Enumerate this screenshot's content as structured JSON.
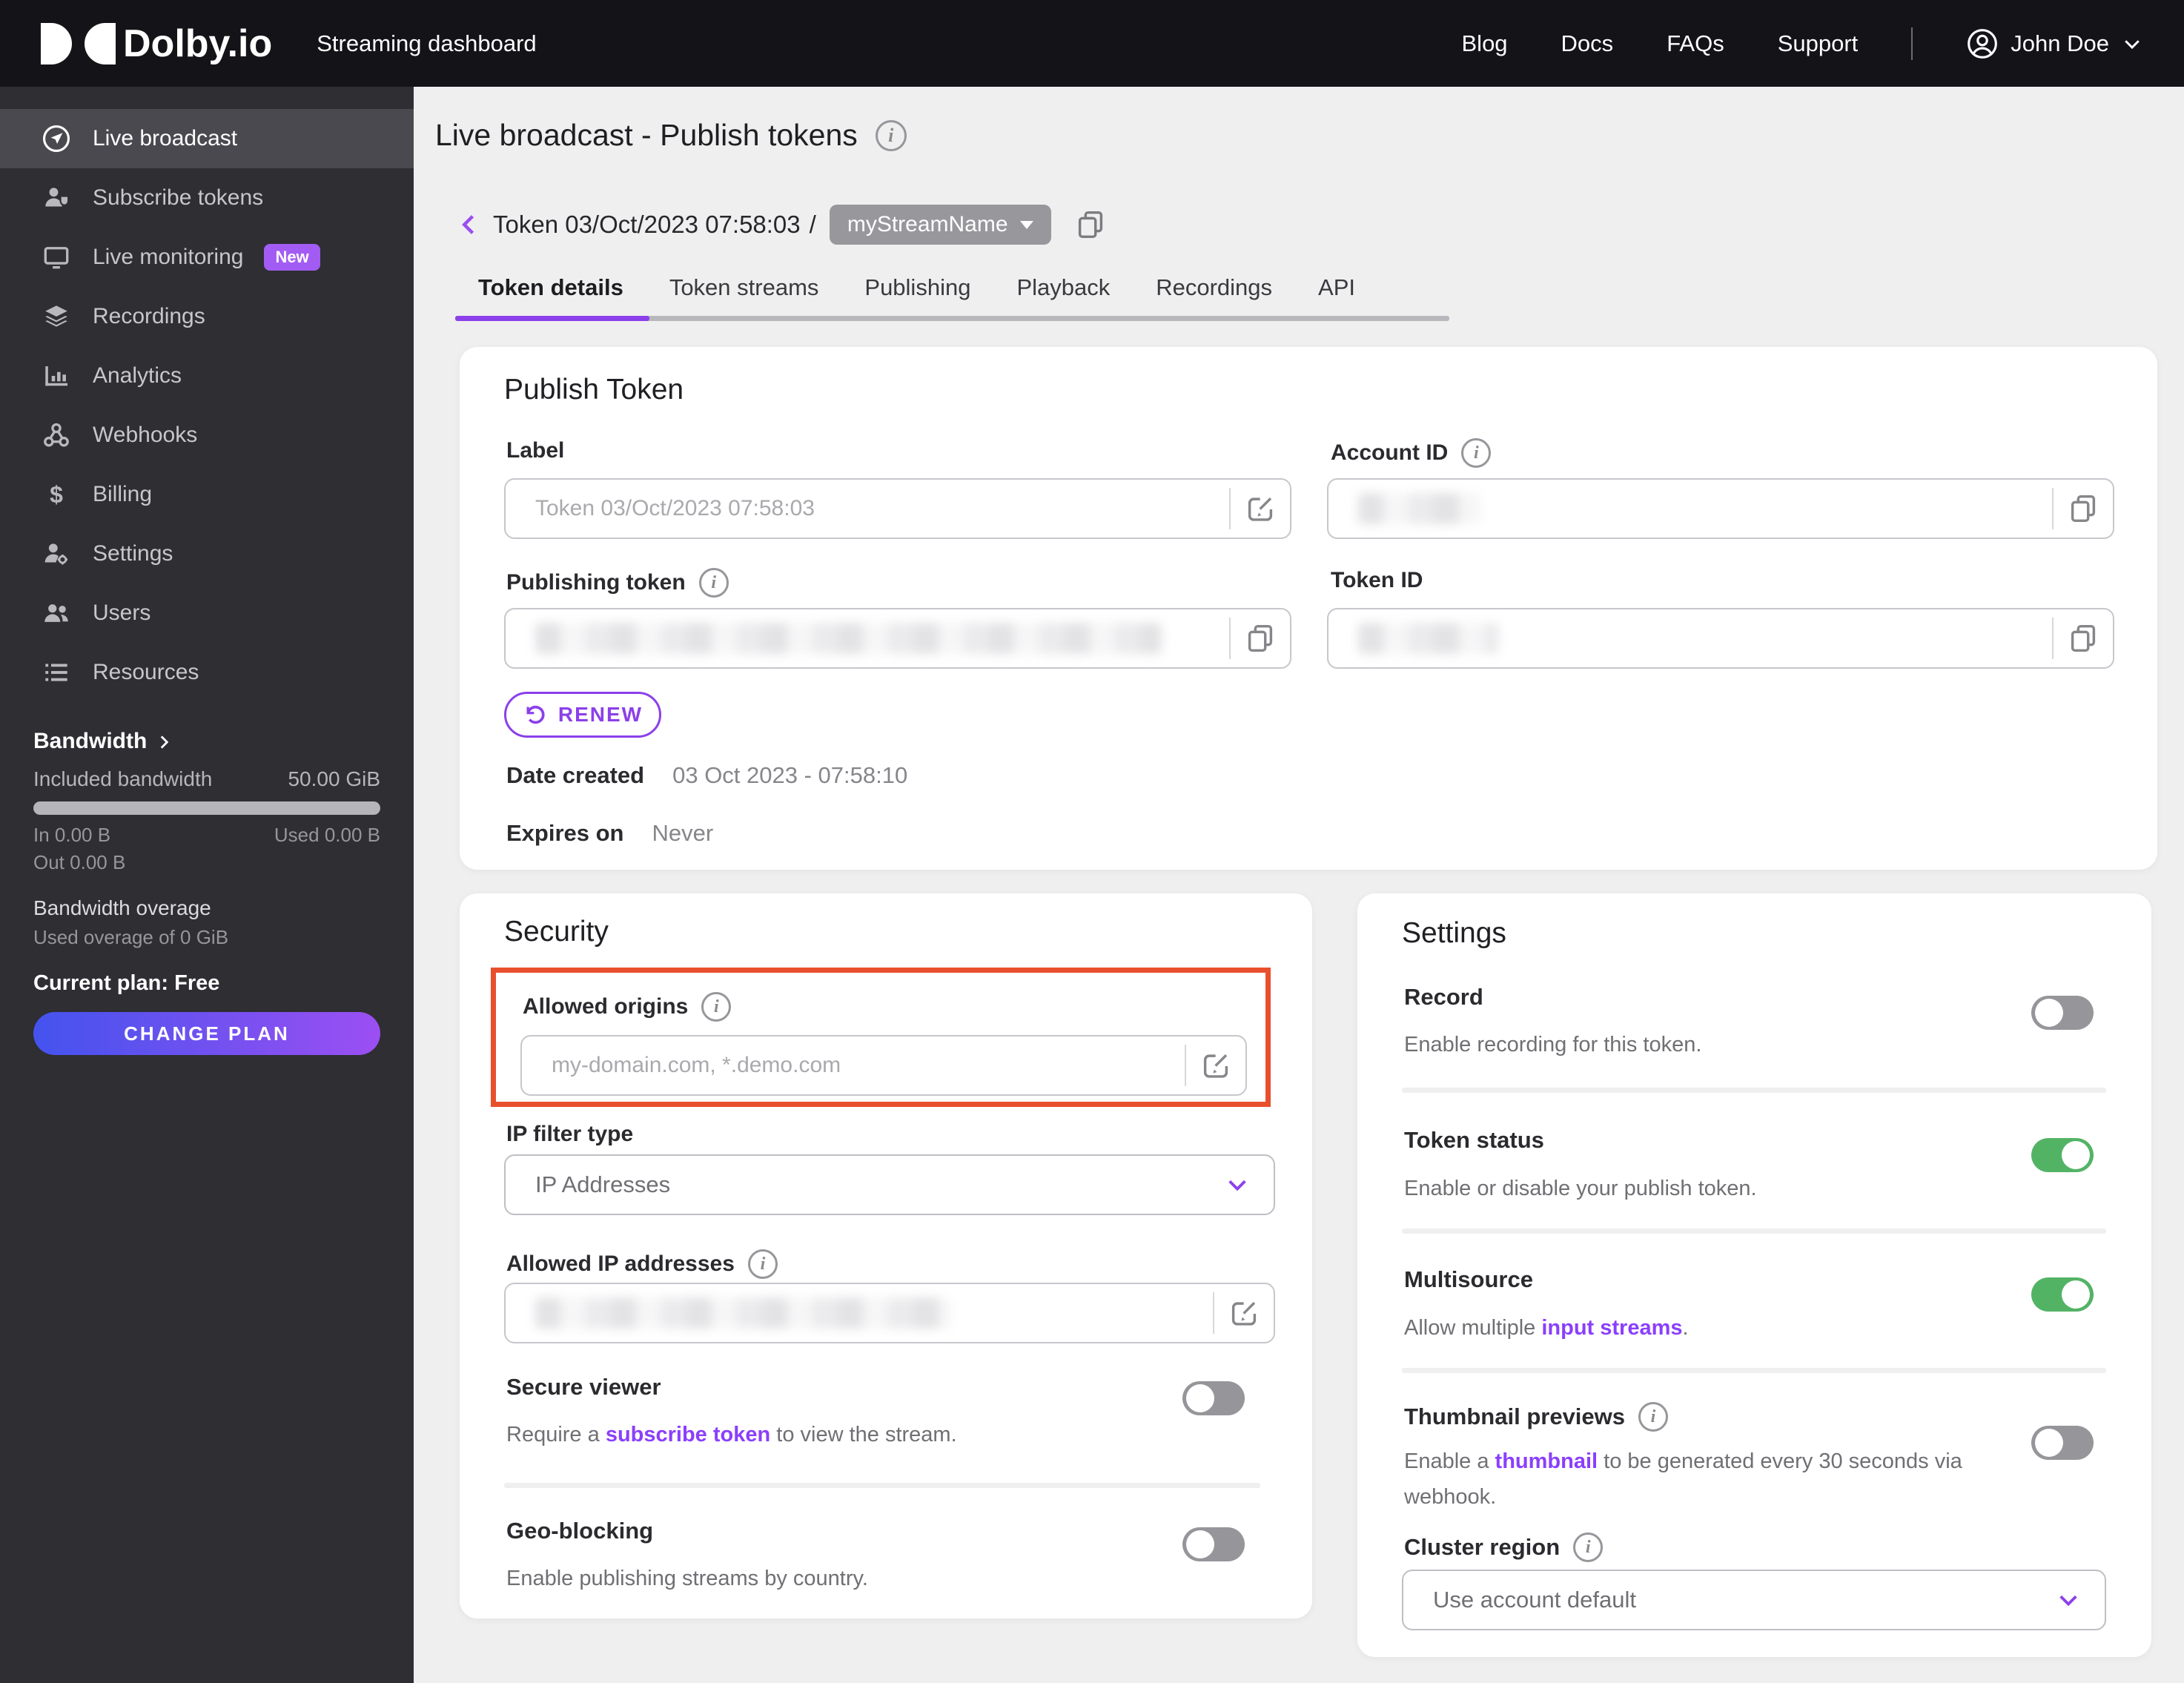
{
  "header": {
    "brand": "Dolby.io",
    "app_title": "Streaming dashboard",
    "nav": [
      {
        "label": "Blog"
      },
      {
        "label": "Docs"
      },
      {
        "label": "FAQs"
      },
      {
        "label": "Support"
      }
    ],
    "user": {
      "name": "John Doe"
    }
  },
  "sidebar": {
    "items": [
      {
        "label": "Live broadcast",
        "active": true
      },
      {
        "label": "Subscribe tokens"
      },
      {
        "label": "Live monitoring",
        "badge": "New"
      },
      {
        "label": "Recordings"
      },
      {
        "label": "Analytics"
      },
      {
        "label": "Webhooks"
      },
      {
        "label": "Billing"
      },
      {
        "label": "Settings"
      },
      {
        "label": "Users"
      },
      {
        "label": "Resources"
      }
    ],
    "bandwidth": {
      "title": "Bandwidth",
      "included_label": "Included bandwidth",
      "included_value": "50.00 GiB",
      "in_label": "In 0.00 B",
      "used_label": "Used 0.00 B",
      "out_label": "Out 0.00 B",
      "overage_title": "Bandwidth overage",
      "overage_sub": "Used overage of 0 GiB",
      "plan": "Current plan: Free",
      "change_plan": "CHANGE PLAN"
    }
  },
  "page": {
    "title": "Live broadcast - Publish tokens",
    "breadcrumb": {
      "token": "Token 03/Oct/2023 07:58:03",
      "separator": "/",
      "stream_pill": "myStreamName"
    },
    "tabs": [
      {
        "label": "Token details",
        "active": true
      },
      {
        "label": "Token streams"
      },
      {
        "label": "Publishing"
      },
      {
        "label": "Playback"
      },
      {
        "label": "Recordings"
      },
      {
        "label": "API"
      }
    ]
  },
  "publish_token": {
    "heading": "Publish Token",
    "label_field": {
      "label": "Label",
      "value": "Token 03/Oct/2023 07:58:03"
    },
    "account_id": {
      "label": "Account ID",
      "value_redacted": true
    },
    "publishing_token": {
      "label": "Publishing token",
      "value_redacted": true
    },
    "token_id": {
      "label": "Token ID",
      "value_redacted": true
    },
    "renew_label": "RENEW",
    "date_created_label": "Date created",
    "date_created_value": "03 Oct 2023 - 07:58:10",
    "expires_label": "Expires on",
    "expires_value": "Never"
  },
  "security": {
    "heading": "Security",
    "allowed_origins": {
      "label": "Allowed origins",
      "placeholder": "my-domain.com, *.demo.com",
      "highlighted": true
    },
    "ip_filter": {
      "label": "IP filter type",
      "value": "IP Addresses"
    },
    "allowed_ips": {
      "label": "Allowed IP addresses",
      "value_redacted": true
    },
    "secure_viewer": {
      "label": "Secure viewer",
      "enabled": false,
      "desc_prefix": "Require a ",
      "desc_link": "subscribe token",
      "desc_suffix": " to view the stream."
    },
    "geo_blocking": {
      "label": "Geo-blocking",
      "enabled": false,
      "desc": "Enable publishing streams by country."
    }
  },
  "settings": {
    "heading": "Settings",
    "record": {
      "label": "Record",
      "desc": "Enable recording for this token.",
      "enabled": false
    },
    "token_status": {
      "label": "Token status",
      "desc": "Enable or disable your publish token.",
      "enabled": true
    },
    "multisource": {
      "label": "Multisource",
      "enabled": true,
      "desc_prefix": "Allow multiple ",
      "desc_link": "input streams",
      "desc_suffix": "."
    },
    "thumbnails": {
      "label": "Thumbnail previews",
      "enabled": false,
      "desc_prefix": "Enable a ",
      "desc_link": "thumbnail",
      "desc_suffix": " to be generated every 30 seconds via webhook."
    },
    "cluster": {
      "label": "Cluster region",
      "value": "Use account default"
    }
  },
  "colors": {
    "accent_purple": "#8b40ea",
    "link_purple": "#8a3ffc",
    "badge_purple": "#a35cf3",
    "highlight_red": "#e8502d",
    "toggle_on_green": "#53b365",
    "gradient_start": "#4453ee",
    "gradient_end": "#9c4ff2"
  }
}
